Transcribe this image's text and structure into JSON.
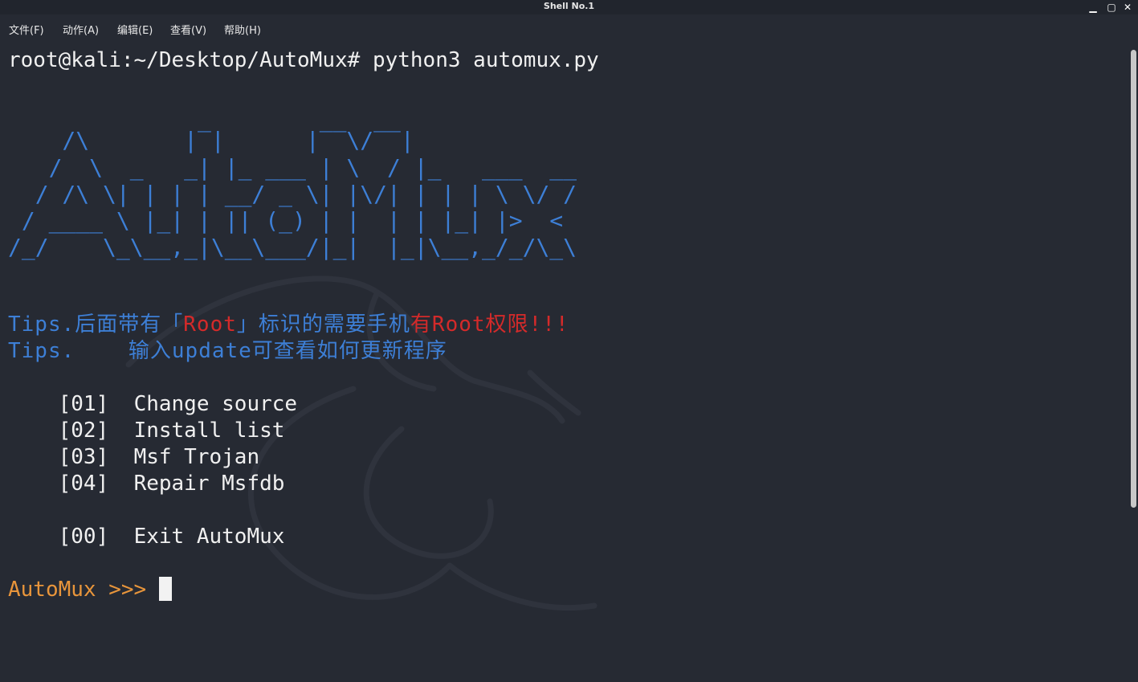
{
  "window": {
    "title": "Shell No.1",
    "controls": {
      "minimize": "▁",
      "maximize": "▢",
      "close": "✕"
    }
  },
  "menubar": {
    "file": "文件(F)",
    "action": "动作(A)",
    "edit": "编辑(E)",
    "view": "查看(V)",
    "help": "帮助(H)"
  },
  "terminal": {
    "command_line": "root@kali:~/Desktop/AutoMux# python3 automux.py",
    "banner": [
      "              _        __  __",
      "    /\\       | |      |  \\/  |",
      "   /  \\  _   _| |_ ___ | \\  / |_   ___  __",
      "  / /\\ \\| | | | __/ _ \\| |\\/| | | | \\ \\/ /",
      " / ____ \\ |_| | || (_) | |  | | |_| |>  <",
      "/_/    \\_\\__,_|\\__\\___/|_|  |_|\\__,_/_/\\_\\"
    ],
    "tip1": {
      "part1": "Tips.后面带有「",
      "part2": "Root",
      "part3": "」标识的需要手机",
      "part4": "有Root权限!!!"
    },
    "tip2": {
      "prefix": "Tips.    ",
      "text": "输入update可查看如何更新程序"
    },
    "menu_options": [
      {
        "num": "[01]",
        "label": "Change source"
      },
      {
        "num": "[02]",
        "label": "Install list"
      },
      {
        "num": "[03]",
        "label": "Msf Trojan"
      },
      {
        "num": "[04]",
        "label": "Repair Msfdb"
      },
      {
        "num": "[00]",
        "label": "Exit AutoMux"
      }
    ],
    "prompt": "AutoMux >>> "
  },
  "colors": {
    "background": "#262a33",
    "banner_blue": "#3d7fd6",
    "tip_red": "#d42a2a",
    "prompt_orange": "#e8953b",
    "text": "#f0f0f0"
  }
}
